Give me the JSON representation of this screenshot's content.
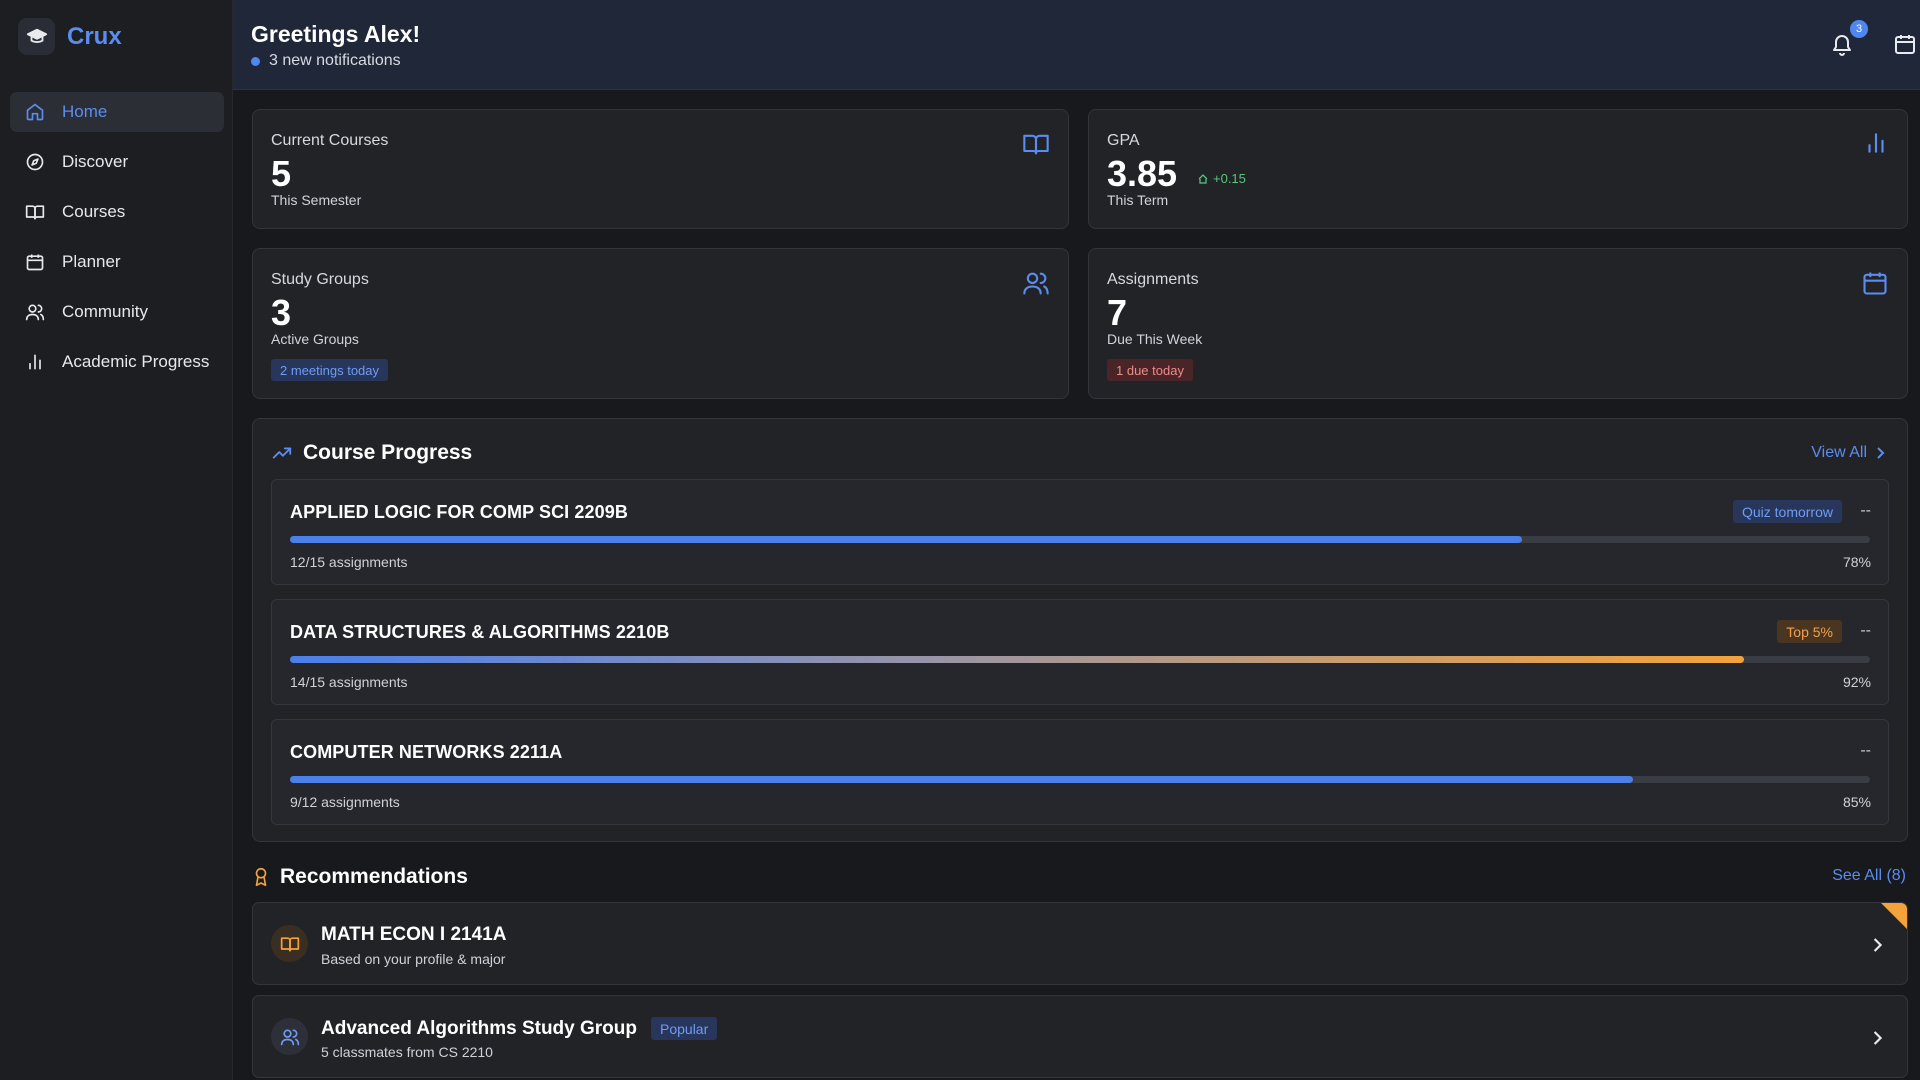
{
  "app": {
    "name": "Crux"
  },
  "sidebar": {
    "items": [
      {
        "label": "Home",
        "icon": "home-icon",
        "active": true
      },
      {
        "label": "Discover",
        "icon": "compass-icon"
      },
      {
        "label": "Courses",
        "icon": "book-icon"
      },
      {
        "label": "Planner",
        "icon": "calendar-icon"
      },
      {
        "label": "Community",
        "icon": "users-icon"
      },
      {
        "label": "Academic Progress",
        "icon": "bar-chart-icon"
      }
    ]
  },
  "header": {
    "greeting": "Greetings Alex!",
    "notifications_text": "3 new notifications",
    "badge_count": "3"
  },
  "stats": {
    "courses": {
      "label": "Current Courses",
      "value": "5",
      "sub": "This Semester"
    },
    "gpa": {
      "label": "GPA",
      "value": "3.85",
      "delta": "+0.15",
      "sub": "This Term"
    },
    "groups": {
      "label": "Study Groups",
      "value": "3",
      "sub": "Active Groups",
      "tag": "2 meetings today"
    },
    "assignments": {
      "label": "Assignments",
      "value": "7",
      "sub": "Due This Week",
      "tag": "1 due today"
    }
  },
  "progress": {
    "title": "Course Progress",
    "view_all": "View All",
    "courses": [
      {
        "name": "APPLIED LOGIC FOR COMP SCI 2209B",
        "tag": "Quiz tomorrow",
        "dash": "--",
        "count": "12/15 assignments",
        "pct": "78%",
        "fraction": 0.78
      },
      {
        "name": "DATA STRUCTURES & ALGORITHMS 2210B",
        "tag": "Top 5%",
        "dash": "--",
        "count": "14/15 assignments",
        "pct": "92%",
        "fraction": 0.92
      },
      {
        "name": "COMPUTER NETWORKS 2211A",
        "tag": "",
        "dash": "--",
        "count": "9/12 assignments",
        "pct": "85%",
        "fraction": 0.85
      }
    ]
  },
  "recommendations": {
    "title": "Recommendations",
    "see_all": "See All (8)",
    "items": [
      {
        "title": "MATH ECON I 2141A",
        "sub": "Based on your profile & major"
      },
      {
        "title": "Advanced Algorithms Study Group",
        "badge": "Popular",
        "sub": "5 classmates from CS 2210"
      }
    ]
  },
  "colors": {
    "accent": "#5b8cf0",
    "orange": "#f3a33a",
    "success": "#58c77b",
    "danger": "#f08a8a"
  }
}
